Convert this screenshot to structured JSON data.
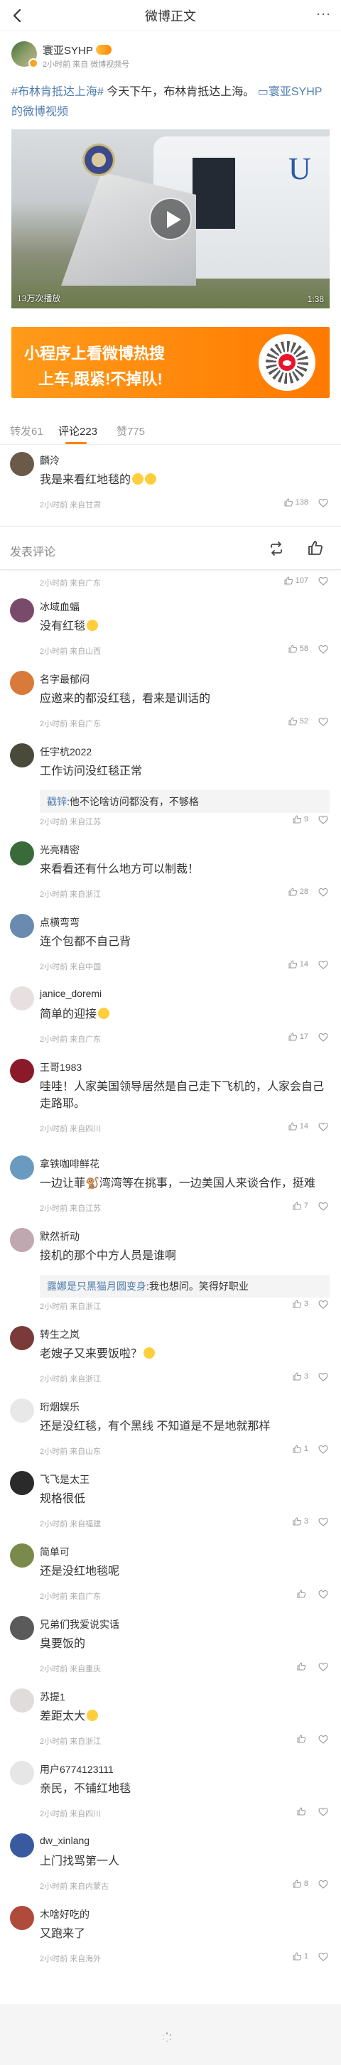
{
  "nav": {
    "title": "微博正文",
    "more": "···"
  },
  "post": {
    "author": "寰亚SYHP",
    "meta": "2小时前 来自 微博视频号",
    "text_tag": "#布林肯抵达上海#",
    "text_body": " 今天下午，布林肯抵达上海。",
    "text_link": "寰亚SYHP的微博视频",
    "video": {
      "views": "13万次播放",
      "duration": "1:38",
      "plane_mark": "U"
    }
  },
  "banner": {
    "line1": "小程序上看微博热搜",
    "line2": "上车,跟紧!不掉队!"
  },
  "tabs": [
    {
      "label": "转发61"
    },
    {
      "label": "评论223"
    },
    {
      "label": "赞775"
    }
  ],
  "reply_bar": {
    "placeholder": "发表评论"
  },
  "comments": [
    {
      "name": "麟泠",
      "text": "我是来看红地毯的",
      "meta": "2小时前 来自甘肃",
      "likes": "138",
      "avatar_color": "#6b5a4a"
    },
    {
      "name": "",
      "text": "",
      "meta": "2小时前 来自广东",
      "likes": "107",
      "avatar_color": "#999999"
    },
    {
      "name": "冰域血蝠",
      "text": "没有红毯",
      "meta": "2小时前 来自山西",
      "likes": "58",
      "avatar_color": "#7a4a6a"
    },
    {
      "name": "名字最郁闷",
      "text": "应邀来的都没红毯，看来是训话的",
      "meta": "2小时前 来自广东",
      "likes": "52",
      "avatar_color": "#d87a3a"
    },
    {
      "name": "任宇杭2022",
      "text": "工作访问没红毯正常",
      "reply_name": "戳锌",
      "reply_text": ":他不论啥访问都没有，不够格",
      "meta": "2小时前 来自江苏",
      "likes": "9",
      "avatar_color": "#4a4a3a"
    },
    {
      "name": "光亮精密",
      "text": "来看看还有什么地方可以制裁！",
      "meta": "2小时前 来自浙江",
      "likes": "28",
      "avatar_color": "#3a6a3a"
    },
    {
      "name": "点横弯弯",
      "text": "连个包都不自己背",
      "meta": "2小时前 来自中国",
      "likes": "14",
      "avatar_color": "#6a8ab0"
    },
    {
      "name": "janice_doremi",
      "text": "简单的迎接",
      "meta": "2小时前 来自广东",
      "likes": "17",
      "avatar_color": "#e8e0e0"
    },
    {
      "name": "王哥1983",
      "text": "哇哇！人家美国领导居然是自己走下飞机的，人家会自己走路耶。",
      "meta": "2小时前 来自四川",
      "likes": "14",
      "avatar_color": "#8a1a2a"
    },
    {
      "name": "拿铁咖啡鲜花",
      "text": "一边让菲🐒湾湾等在挑事，一边美国人来谈合作，挺难",
      "meta": "2小时前 来自江苏",
      "likes": "7",
      "avatar_color": "#6a9ac0"
    },
    {
      "name": "默然祈动",
      "text": "接机的那个中方人员是谁啊",
      "reply_name": "露娜是只黑猫月圆变身",
      "reply_text": ":我也想问。笑得好职业",
      "meta": "2小时前 来自浙江",
      "likes": "3",
      "avatar_color": "#c0a8b0"
    },
    {
      "name": "转生之岚",
      "text": "老嫂子又来要饭啦？",
      "meta": "2小时前 来自浙江",
      "likes": "3",
      "avatar_color": "#7a3a3a"
    },
    {
      "name": "珩烟娱乐",
      "text": "还是没红毯，有个黑线 不知道是不是地就那样",
      "meta": "2小时前 来自山东",
      "likes": "1",
      "avatar_color": "#e8e8e8"
    },
    {
      "name": "飞飞是太王",
      "text": "规格很低",
      "meta": "2小时前 来自福建",
      "likes": "3",
      "avatar_color": "#2a2a2a"
    },
    {
      "name": "简单可",
      "text": "还是没红地毯呢",
      "meta": "2小时前 来自广东",
      "likes": "",
      "avatar_color": "#7a8a4a"
    },
    {
      "name": "兄弟们我爱说实话",
      "text": "臭要饭的",
      "meta": "2小时前 来自重庆",
      "likes": "",
      "avatar_color": "#5a5a5a"
    },
    {
      "name": "苏提1",
      "text": "差距太大",
      "meta": "2小时前 来自浙江",
      "likes": "",
      "avatar_color": "#e0dcdc"
    },
    {
      "name": "用户6774123111",
      "text": "亲民，不铺红地毯",
      "meta": "2小时前 来自四川",
      "likes": "",
      "avatar_color": "#e6e6e6"
    },
    {
      "name": "dw_xinlang",
      "text": "上门找骂第一人",
      "meta": "2小时前 来自内蒙古",
      "likes": "8",
      "avatar_color": "#3a5aa0"
    },
    {
      "name": "木啥好吃的",
      "text": "又跑来了",
      "meta": "2小时前 来自海外",
      "likes": "1",
      "avatar_color": "#b04a3a"
    }
  ]
}
